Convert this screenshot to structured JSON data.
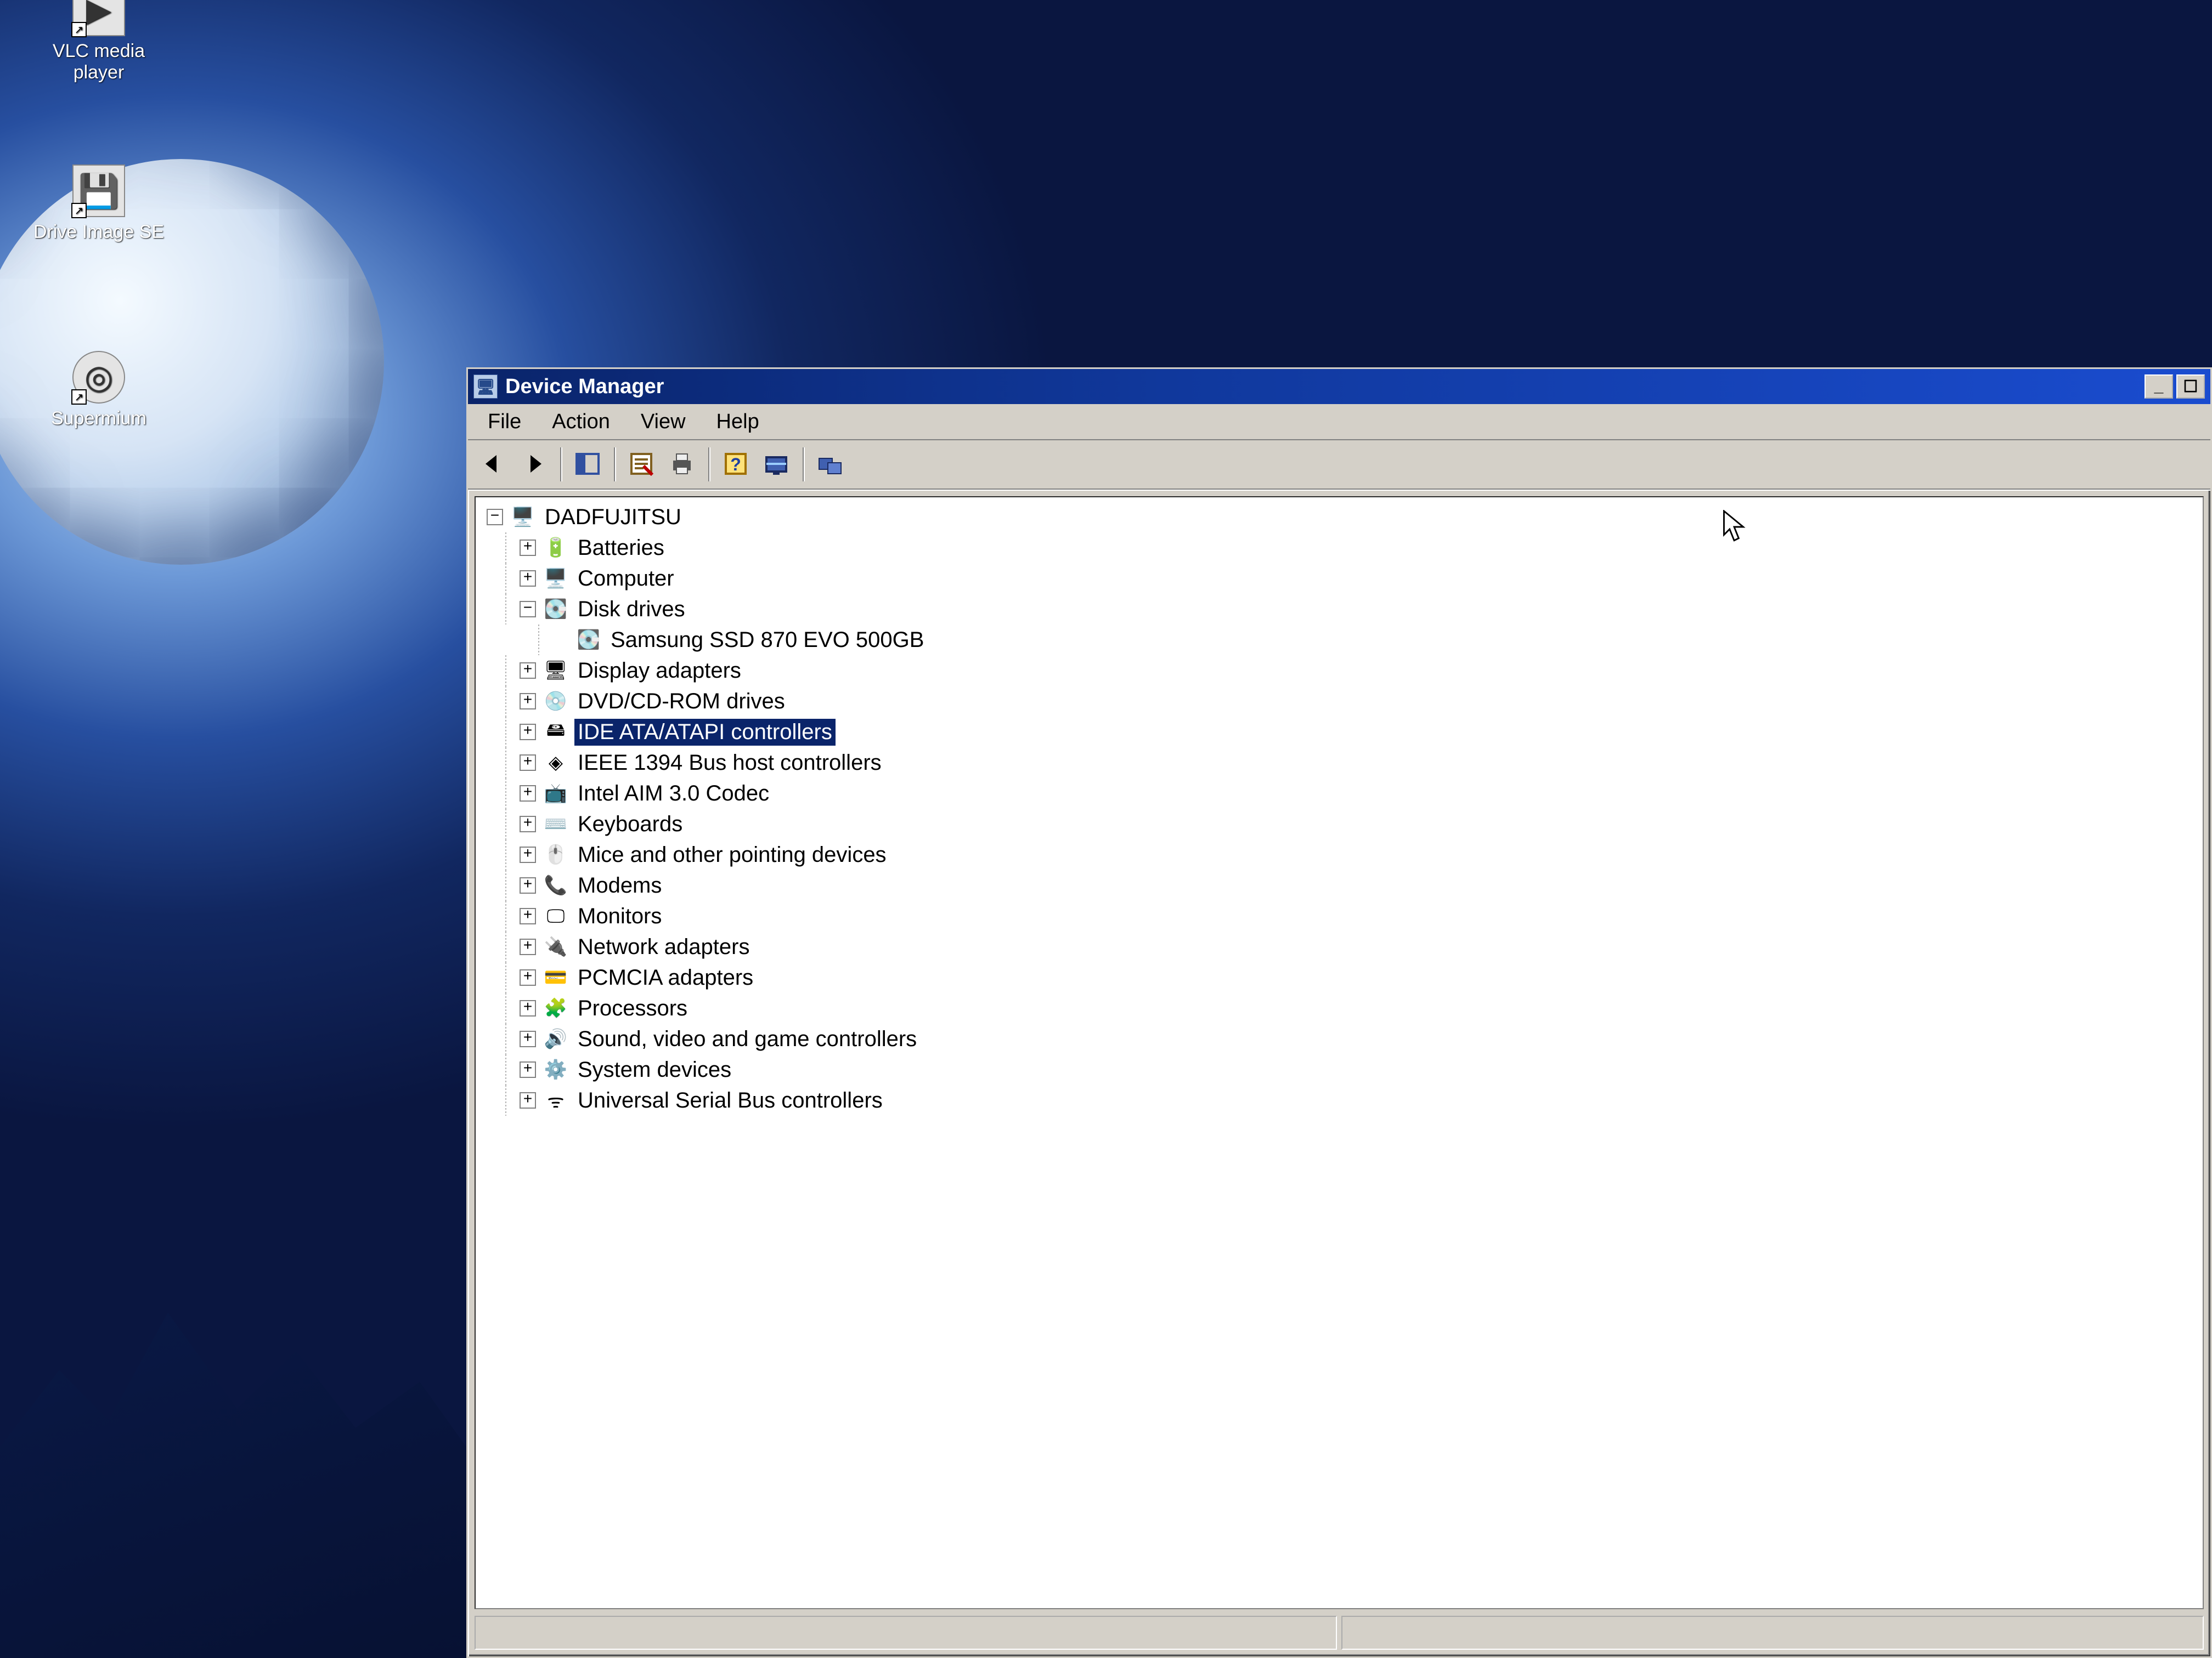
{
  "desktop": {
    "icons": [
      {
        "id": "vlc",
        "label": "VLC media player"
      },
      {
        "id": "driveimage",
        "label": "Drive Image SE"
      },
      {
        "id": "supermium",
        "label": "Supermium"
      }
    ]
  },
  "window": {
    "title": "Device Manager",
    "menu": [
      "File",
      "Action",
      "View",
      "Help"
    ],
    "toolbar": [
      {
        "id": "back",
        "name": "back-button",
        "glyph": "arrow-left",
        "enabled": true
      },
      {
        "id": "forward",
        "name": "forward-button",
        "glyph": "arrow-right",
        "enabled": true
      },
      {
        "sep": true
      },
      {
        "id": "up",
        "name": "show-hide-tree-button",
        "glyph": "tree",
        "enabled": true
      },
      {
        "sep": true
      },
      {
        "id": "properties",
        "name": "properties-button",
        "glyph": "props",
        "enabled": true
      },
      {
        "id": "print",
        "name": "print-button",
        "glyph": "printer",
        "enabled": true
      },
      {
        "sep": true
      },
      {
        "id": "help",
        "name": "help-button",
        "glyph": "help",
        "enabled": true
      },
      {
        "id": "scan",
        "name": "scan-hardware-button",
        "glyph": "scan",
        "enabled": true
      },
      {
        "sep": true
      },
      {
        "id": "remote",
        "name": "remote-computer-button",
        "glyph": "remote",
        "enabled": true
      }
    ],
    "status_panes": 2
  },
  "tree": {
    "root": "DADFUJITSU",
    "root_icon": "computer",
    "nodes": [
      {
        "label": "Batteries",
        "icon": "battery",
        "expanded": false,
        "children": []
      },
      {
        "label": "Computer",
        "icon": "computer",
        "expanded": false,
        "children": []
      },
      {
        "label": "Disk drives",
        "icon": "disk",
        "expanded": true,
        "children": [
          {
            "label": "Samsung SSD 870 EVO 500GB",
            "icon": "disk"
          }
        ]
      },
      {
        "label": "Display adapters",
        "icon": "display",
        "expanded": false,
        "children": []
      },
      {
        "label": "DVD/CD-ROM drives",
        "icon": "cdrom",
        "expanded": false,
        "children": []
      },
      {
        "label": "IDE ATA/ATAPI controllers",
        "icon": "ide",
        "expanded": false,
        "children": [],
        "selected": true
      },
      {
        "label": "IEEE 1394 Bus host controllers",
        "icon": "firewire",
        "expanded": false,
        "children": []
      },
      {
        "label": "Intel AIM 3.0 Codec",
        "icon": "codec",
        "expanded": false,
        "children": []
      },
      {
        "label": "Keyboards",
        "icon": "keyboard",
        "expanded": false,
        "children": []
      },
      {
        "label": "Mice and other pointing devices",
        "icon": "mouse",
        "expanded": false,
        "children": []
      },
      {
        "label": "Modems",
        "icon": "modem",
        "expanded": false,
        "children": []
      },
      {
        "label": "Monitors",
        "icon": "monitor",
        "expanded": false,
        "children": []
      },
      {
        "label": "Network adapters",
        "icon": "network",
        "expanded": false,
        "children": []
      },
      {
        "label": "PCMCIA adapters",
        "icon": "pcmcia",
        "expanded": false,
        "children": []
      },
      {
        "label": "Processors",
        "icon": "cpu",
        "expanded": false,
        "children": []
      },
      {
        "label": "Sound, video and game controllers",
        "icon": "sound",
        "expanded": false,
        "children": []
      },
      {
        "label": "System devices",
        "icon": "system",
        "expanded": false,
        "children": []
      },
      {
        "label": "Universal Serial Bus controllers",
        "icon": "usb",
        "expanded": false,
        "children": []
      }
    ]
  }
}
